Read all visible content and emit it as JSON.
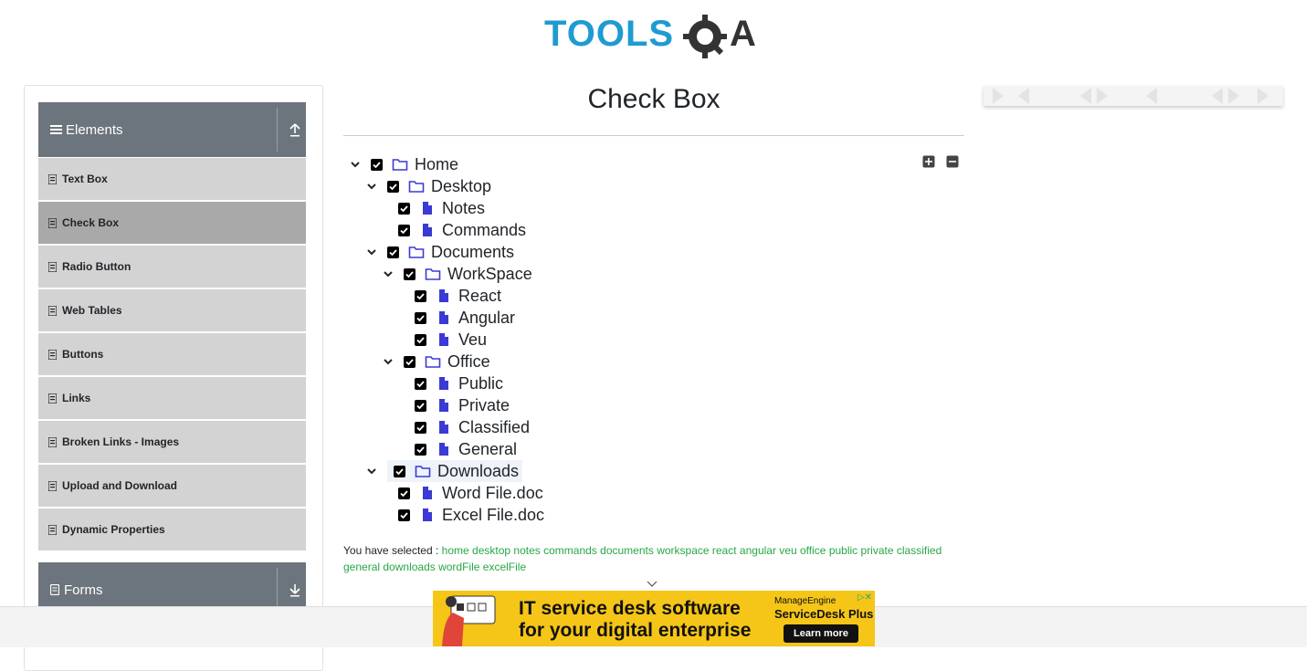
{
  "brand": {
    "logo_text": "TOOLSQA"
  },
  "sidebar": {
    "groups": [
      {
        "label": "Elements"
      },
      {
        "label": "Forms"
      }
    ],
    "items": [
      {
        "label": "Text Box"
      },
      {
        "label": "Check Box"
      },
      {
        "label": "Radio Button"
      },
      {
        "label": "Web Tables"
      },
      {
        "label": "Buttons"
      },
      {
        "label": "Links"
      },
      {
        "label": "Broken Links - Images"
      },
      {
        "label": "Upload and Download"
      },
      {
        "label": "Dynamic Properties"
      }
    ],
    "active_item": "Check Box"
  },
  "main": {
    "title": "Check Box",
    "tree": [
      {
        "label": "Home",
        "type": "folder",
        "checked": true,
        "expanded": true
      },
      {
        "label": "Desktop",
        "type": "folder",
        "checked": true,
        "expanded": true
      },
      {
        "label": "Notes",
        "type": "file",
        "checked": true
      },
      {
        "label": "Commands",
        "type": "file",
        "checked": true
      },
      {
        "label": "Documents",
        "type": "folder",
        "checked": true,
        "expanded": true
      },
      {
        "label": "WorkSpace",
        "type": "folder",
        "checked": true,
        "expanded": true
      },
      {
        "label": "React",
        "type": "file",
        "checked": true
      },
      {
        "label": "Angular",
        "type": "file",
        "checked": true
      },
      {
        "label": "Veu",
        "type": "file",
        "checked": true
      },
      {
        "label": "Office",
        "type": "folder",
        "checked": true,
        "expanded": true
      },
      {
        "label": "Public",
        "type": "file",
        "checked": true
      },
      {
        "label": "Private",
        "type": "file",
        "checked": true
      },
      {
        "label": "Classified",
        "type": "file",
        "checked": true
      },
      {
        "label": "General",
        "type": "file",
        "checked": true
      },
      {
        "label": "Downloads",
        "type": "folder",
        "checked": true,
        "expanded": true
      },
      {
        "label": "Word File.doc",
        "type": "file",
        "checked": true
      },
      {
        "label": "Excel File.doc",
        "type": "file",
        "checked": true
      }
    ],
    "result_prefix": "You have selected :",
    "selected": [
      "home",
      "desktop",
      "notes",
      "commands",
      "documents",
      "workspace",
      "react",
      "angular",
      "veu",
      "office",
      "public",
      "private",
      "classified",
      "general",
      "downloads",
      "wordFile",
      "excelFile"
    ]
  },
  "ad": {
    "headline_1": "IT service desk software",
    "headline_2": "for your digital enterprise",
    "brand_small": "ManageEngine",
    "brand_name": "ServiceDesk Plus",
    "cta": "Learn more"
  },
  "colors": {
    "accent": "#1e90ff",
    "sidebar_header": "#6c757d",
    "menu_item": "#d3d3d3",
    "menu_active": "#a9a9a9",
    "selected_text": "#28a745",
    "tree_icon": "#3a3ad4"
  }
}
